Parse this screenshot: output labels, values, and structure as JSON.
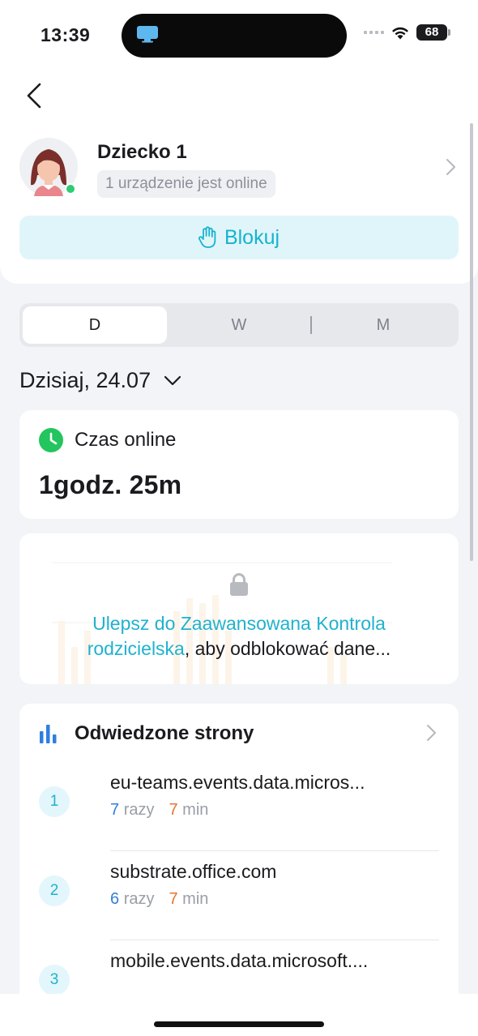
{
  "status_bar": {
    "time": "13:39",
    "battery": "68",
    "icons": [
      "screen-time-app-icon",
      "signal-icon",
      "wifi-icon",
      "battery-icon"
    ]
  },
  "nav": {
    "back_icon": "chevron-left-icon"
  },
  "profile": {
    "name": "Dziecko 1",
    "device_status": "1 urządzenie jest online",
    "online": true,
    "block_label": "Blokuj",
    "block_icon": "hand-icon"
  },
  "period_tabs": {
    "items": [
      "D",
      "W",
      "M"
    ],
    "selected": "D"
  },
  "date": {
    "label": "Dzisiaj, 24.07",
    "icon": "chevron-down-icon"
  },
  "online_time": {
    "title": "Czas online",
    "value": "1godz. 25m",
    "icon": "clock-icon",
    "accent": "#22c55e"
  },
  "locked": {
    "link_text": "Ulepsz do Zaawansowana Kontrola rodzicielska",
    "rest_text": ", aby odblokować dane...",
    "icon": "lock-icon"
  },
  "visited_sites": {
    "title": "Odwiedzone strony",
    "icon": "bar-chart-icon",
    "items": [
      {
        "rank": "1",
        "domain": "eu-teams.events.data.micros...",
        "count": "7",
        "count_unit": "razy",
        "minutes": "7",
        "minutes_unit": "min"
      },
      {
        "rank": "2",
        "domain": "substrate.office.com",
        "count": "6",
        "count_unit": "razy",
        "minutes": "7",
        "minutes_unit": "min"
      },
      {
        "rank": "3",
        "domain": "mobile.events.data.microsoft....",
        "count": "",
        "count_unit": "",
        "minutes": "",
        "minutes_unit": ""
      }
    ]
  },
  "colors": {
    "accent": "#1fb2cf",
    "block_bg": "#e0f5fa",
    "count_color": "#2f80d8",
    "minutes_color": "#e8752f"
  }
}
